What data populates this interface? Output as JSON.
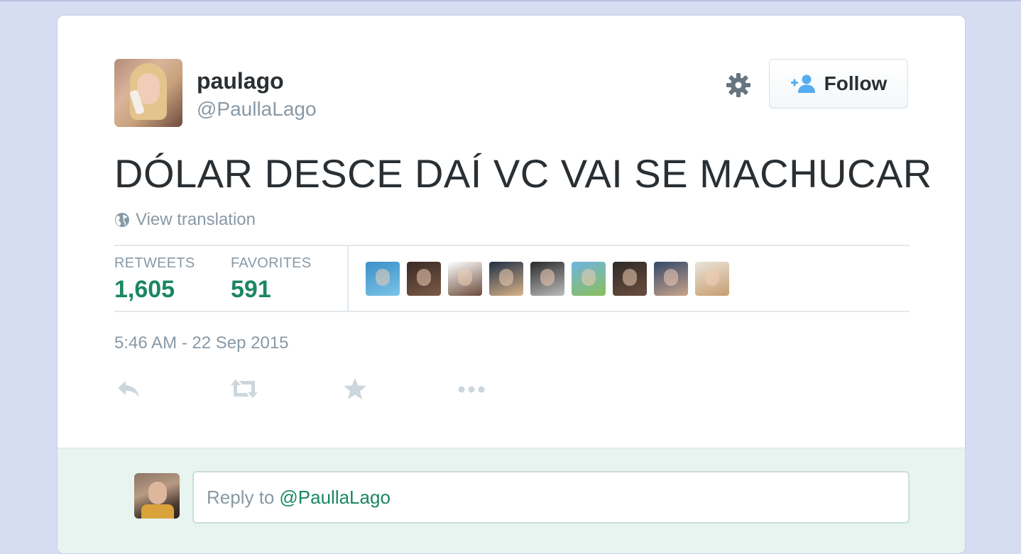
{
  "tweet": {
    "author": {
      "display_name": "paulago",
      "screen_name": "@PaullaLago"
    },
    "follow_label": "Follow",
    "text": "DÓLAR DESCE DAÍ VC VAI SE MACHUCAR",
    "view_translation": "View translation",
    "stats": {
      "retweets_label": "RETWEETS",
      "retweets_value": "1,605",
      "favorites_label": "FAVORITES",
      "favorites_value": "591"
    },
    "favoriters": [
      {
        "name": "favoriter-1",
        "color_a": "#3b8fc9",
        "color_b": "#7cc4e6"
      },
      {
        "name": "favoriter-2",
        "color_a": "#3a2a24",
        "color_b": "#7a5a48"
      },
      {
        "name": "favoriter-3",
        "color_a": "#ffffff",
        "color_b": "#6a4a3a"
      },
      {
        "name": "favoriter-4",
        "color_a": "#1f2f45",
        "color_b": "#d9b48a"
      },
      {
        "name": "favoriter-5",
        "color_a": "#2a2a2a",
        "color_b": "#bdbdbd"
      },
      {
        "name": "favoriter-6",
        "color_a": "#6fb4e0",
        "color_b": "#8bbf5a"
      },
      {
        "name": "favoriter-7",
        "color_a": "#2f2a28",
        "color_b": "#6a4e3e"
      },
      {
        "name": "favoriter-8",
        "color_a": "#33486a",
        "color_b": "#c9a48a"
      },
      {
        "name": "favoriter-9",
        "color_a": "#e9e4dc",
        "color_b": "#c79d6e"
      }
    ],
    "timestamp": "5:46 AM - 22 Sep 2015"
  },
  "reply": {
    "placeholder_prefix": "Reply to",
    "placeholder_mention": "@PaullaLago"
  },
  "icons": {
    "gear": "gear-icon",
    "follow": "add-user-icon",
    "globe": "globe-icon",
    "reply": "reply-icon",
    "retweet": "retweet-icon",
    "favorite": "star-icon",
    "more": "more-icon"
  },
  "colors": {
    "background": "#d6dcf2",
    "card": "#ffffff",
    "text": "#292f33",
    "muted": "#8899a6",
    "accent_green": "#1a8760",
    "follow_icon_blue": "#55acee",
    "reply_area": "#e8f4ef"
  }
}
